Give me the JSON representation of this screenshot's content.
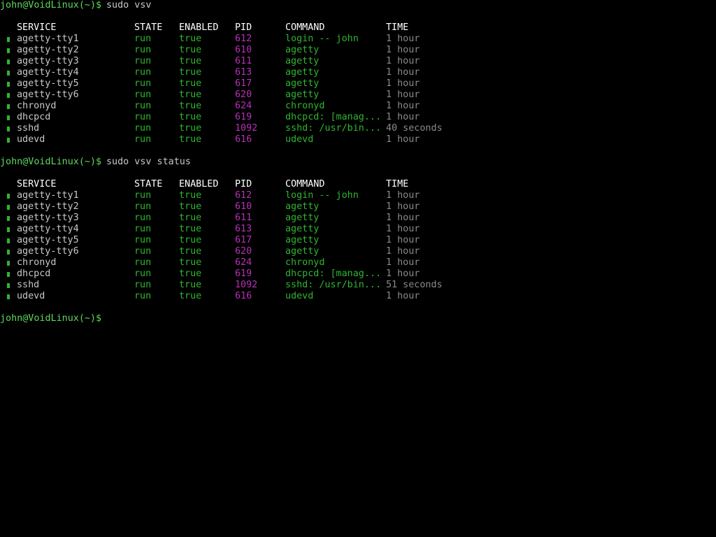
{
  "colors": {
    "background": "#000000",
    "prompt": "#5fd75f",
    "header": "#ffffff",
    "service": "#c8c8c8",
    "state_enabled_command": "#2fb52f",
    "pid": "#b82fb8",
    "time": "#8a8a8a",
    "status_bullet": "#2fb52f"
  },
  "prompt": "john@VoidLinux(~)$",
  "blocks": [
    {
      "command": "sudo vsv",
      "headers": [
        "SERVICE",
        "STATE",
        "ENABLED",
        "PID",
        "COMMAND",
        "TIME"
      ],
      "rows": [
        {
          "service": "agetty-tty1",
          "state": "run",
          "enabled": "true",
          "pid": "612",
          "command": "login -- john",
          "time": "1 hour"
        },
        {
          "service": "agetty-tty2",
          "state": "run",
          "enabled": "true",
          "pid": "610",
          "command": "agetty",
          "time": "1 hour"
        },
        {
          "service": "agetty-tty3",
          "state": "run",
          "enabled": "true",
          "pid": "611",
          "command": "agetty",
          "time": "1 hour"
        },
        {
          "service": "agetty-tty4",
          "state": "run",
          "enabled": "true",
          "pid": "613",
          "command": "agetty",
          "time": "1 hour"
        },
        {
          "service": "agetty-tty5",
          "state": "run",
          "enabled": "true",
          "pid": "617",
          "command": "agetty",
          "time": "1 hour"
        },
        {
          "service": "agetty-tty6",
          "state": "run",
          "enabled": "true",
          "pid": "620",
          "command": "agetty",
          "time": "1 hour"
        },
        {
          "service": "chronyd",
          "state": "run",
          "enabled": "true",
          "pid": "624",
          "command": "chronyd",
          "time": "1 hour"
        },
        {
          "service": "dhcpcd",
          "state": "run",
          "enabled": "true",
          "pid": "619",
          "command": "dhcpcd: [manag...",
          "time": "1 hour"
        },
        {
          "service": "sshd",
          "state": "run",
          "enabled": "true",
          "pid": "1092",
          "command": "sshd: /usr/bin...",
          "time": "40 seconds"
        },
        {
          "service": "udevd",
          "state": "run",
          "enabled": "true",
          "pid": "616",
          "command": "udevd",
          "time": "1 hour"
        }
      ]
    },
    {
      "command": "sudo vsv status",
      "headers": [
        "SERVICE",
        "STATE",
        "ENABLED",
        "PID",
        "COMMAND",
        "TIME"
      ],
      "rows": [
        {
          "service": "agetty-tty1",
          "state": "run",
          "enabled": "true",
          "pid": "612",
          "command": "login -- john",
          "time": "1 hour"
        },
        {
          "service": "agetty-tty2",
          "state": "run",
          "enabled": "true",
          "pid": "610",
          "command": "agetty",
          "time": "1 hour"
        },
        {
          "service": "agetty-tty3",
          "state": "run",
          "enabled": "true",
          "pid": "611",
          "command": "agetty",
          "time": "1 hour"
        },
        {
          "service": "agetty-tty4",
          "state": "run",
          "enabled": "true",
          "pid": "613",
          "command": "agetty",
          "time": "1 hour"
        },
        {
          "service": "agetty-tty5",
          "state": "run",
          "enabled": "true",
          "pid": "617",
          "command": "agetty",
          "time": "1 hour"
        },
        {
          "service": "agetty-tty6",
          "state": "run",
          "enabled": "true",
          "pid": "620",
          "command": "agetty",
          "time": "1 hour"
        },
        {
          "service": "chronyd",
          "state": "run",
          "enabled": "true",
          "pid": "624",
          "command": "chronyd",
          "time": "1 hour"
        },
        {
          "service": "dhcpcd",
          "state": "run",
          "enabled": "true",
          "pid": "619",
          "command": "dhcpcd: [manag...",
          "time": "1 hour"
        },
        {
          "service": "sshd",
          "state": "run",
          "enabled": "true",
          "pid": "1092",
          "command": "sshd: /usr/bin...",
          "time": "51 seconds"
        },
        {
          "service": "udevd",
          "state": "run",
          "enabled": "true",
          "pid": "616",
          "command": "udevd",
          "time": "1 hour"
        }
      ]
    }
  ],
  "final_prompt": {
    "command": ""
  }
}
